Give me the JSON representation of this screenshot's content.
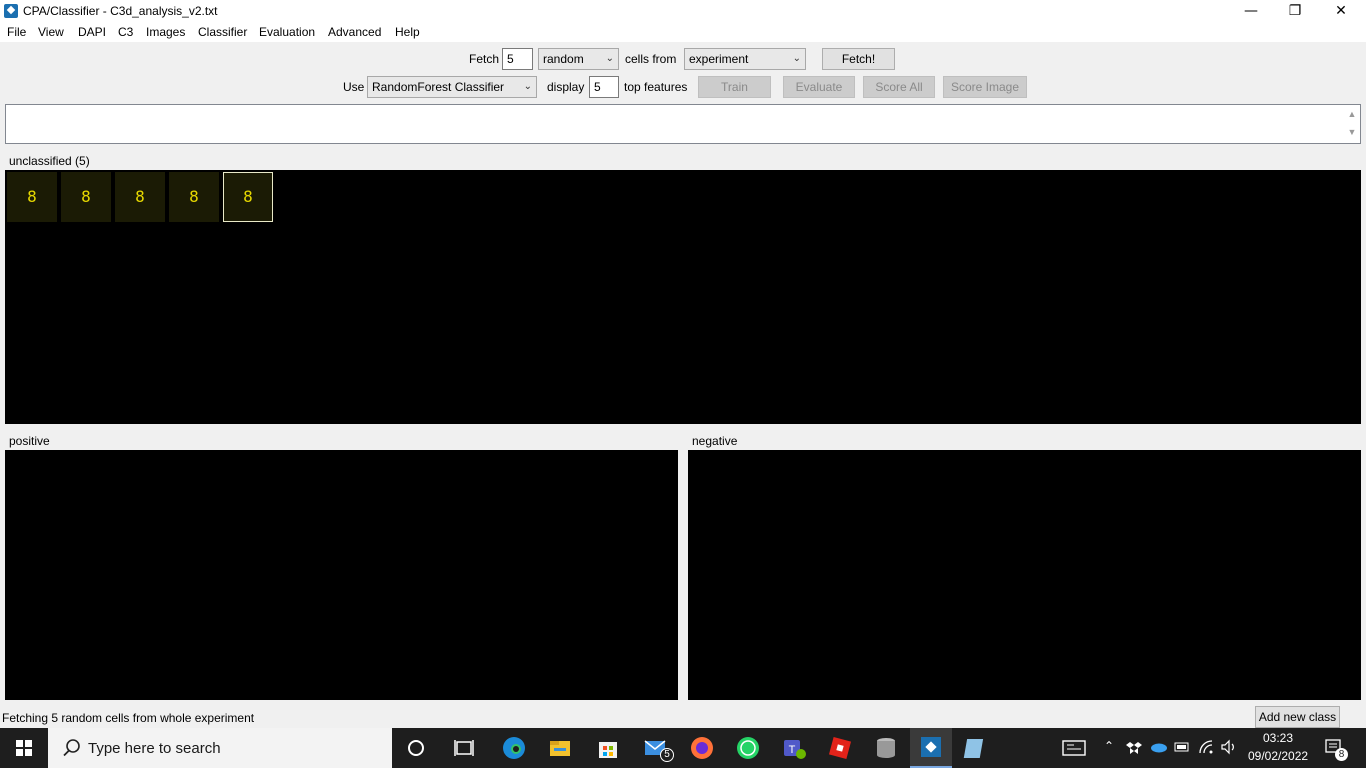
{
  "window": {
    "title": "CPA/Classifier - C3d_analysis_v2.txt",
    "minimize": "—",
    "maximize": "❐",
    "close": "✕"
  },
  "menu": [
    "File",
    "View",
    "DAPI",
    "C3",
    "Images",
    "Classifier",
    "Evaluation",
    "Advanced",
    "Help"
  ],
  "fetch_row": {
    "fetch_label": "Fetch",
    "count_value": "5",
    "mode_value": "random",
    "cells_from_label": "cells from",
    "source_value": "experiment",
    "fetch_button": "Fetch!"
  },
  "use_row": {
    "use_label": "Use",
    "classifier_value": "RandomForest Classifier",
    "display_label": "display",
    "features_value": "5",
    "top_features_label": "top features",
    "train_button": "Train",
    "evaluate_button": "Evaluate",
    "score_all_button": "Score All",
    "score_image_button": "Score Image"
  },
  "bins": {
    "unclassified_label": "unclassified (5)",
    "unclassified_tiles": [
      "8",
      "8",
      "8",
      "8",
      "8"
    ],
    "positive_label": "positive",
    "negative_label": "negative"
  },
  "status": {
    "text": "Fetching 5 random cells from whole experiment",
    "add_class_button": "Add new class"
  },
  "taskbar": {
    "search_placeholder": "Type here to search",
    "mail_badge": "5",
    "time": "03:23",
    "date": "09/02/2022",
    "notification_count": "8"
  }
}
